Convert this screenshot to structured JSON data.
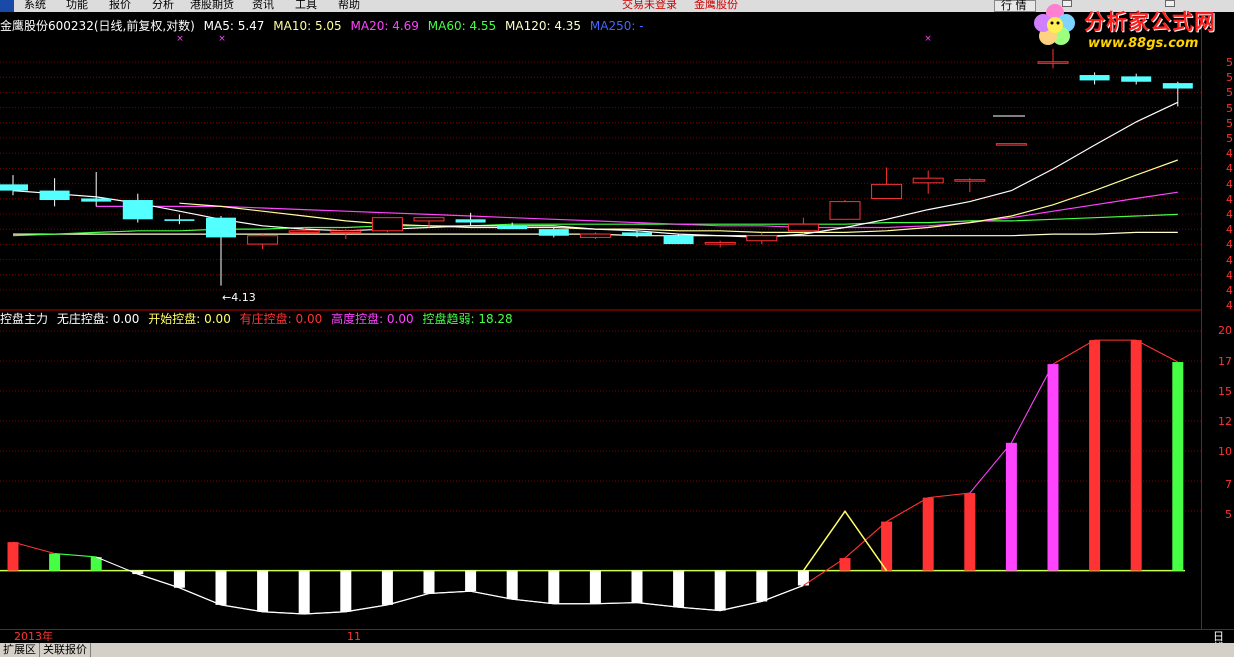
{
  "menu": {
    "items": [
      "系统",
      "功能",
      "报价",
      "分析",
      "港股期货",
      "资讯",
      "工具",
      "帮助"
    ],
    "status_login": "交易未登录",
    "status_name": "金鹰股份",
    "quote_button": "行 情"
  },
  "logo": {
    "title": "分析家公式网",
    "url": "www.88gs.com"
  },
  "price_header": {
    "stock": "金鹰股份",
    "code_desc": "600232(日线,前复权,对数)",
    "ma5": "MA5: 5.47",
    "ma10": "MA10: 5.05",
    "ma20": "MA20: 4.69",
    "ma60": "MA60: 4.55",
    "ma120": "MA120: 4.35",
    "ma250": "MA250: -"
  },
  "indicator_header": {
    "name": "控盘主力",
    "no_control": "无庄控盘: 0.00",
    "start_control": "开始控盘: 0.00",
    "has_control": "有庄控盘: 0.00",
    "high_control": "高度控盘: 0.00",
    "trend": "控盘趋弱: 18.28"
  },
  "annotations": {
    "low_price": "4.13"
  },
  "price_axis_ticks": [
    "5",
    "5",
    "5",
    "5",
    "5",
    "5",
    "4",
    "4",
    "4",
    "4",
    "4",
    "4",
    "4",
    "4",
    "4",
    "4",
    "4"
  ],
  "indicator_axis_ticks": [
    "20",
    "17",
    "15",
    "12",
    "10",
    "7",
    "5"
  ],
  "bottom_axis": {
    "date_left": "2013年",
    "date_mid": "11",
    "frequency": "日线"
  },
  "tabs": [
    "扩展区",
    "关联报价"
  ],
  "colors": {
    "up": "#ff3333",
    "down": "#54ffff",
    "ma5": "#ffffff",
    "ma10": "#ffff99",
    "ma20": "#ff44ff",
    "ma60": "#44ff44",
    "ma120": "#ffffcc",
    "ma250": "#4466ff",
    "no_control": "#ffffff",
    "start_control": "#ffff66",
    "has_control": "#ff3333",
    "high_control": "#ff44ff",
    "trend": "#44ff44",
    "grid": "#7a0000"
  },
  "chart_data": [
    {
      "type": "candlestick",
      "title": "金鹰股份",
      "candles": [
        {
          "o": 4.74,
          "h": 4.8,
          "l": 4.67,
          "c": 4.7
        },
        {
          "o": 4.7,
          "h": 4.78,
          "l": 4.6,
          "c": 4.64
        },
        {
          "o": 4.65,
          "h": 4.82,
          "l": 4.6,
          "c": 4.63
        },
        {
          "o": 4.64,
          "h": 4.68,
          "l": 4.5,
          "c": 4.52
        },
        {
          "o": 4.52,
          "h": 4.55,
          "l": 4.49,
          "c": 4.51
        },
        {
          "o": 4.53,
          "h": 4.54,
          "l": 4.13,
          "c": 4.41
        },
        {
          "o": 4.37,
          "h": 4.43,
          "l": 4.34,
          "c": 4.42
        },
        {
          "o": 4.44,
          "h": 4.47,
          "l": 4.43,
          "c": 4.45
        },
        {
          "o": 4.44,
          "h": 4.46,
          "l": 4.4,
          "c": 4.45
        },
        {
          "o": 4.45,
          "h": 4.52,
          "l": 4.44,
          "c": 4.53
        },
        {
          "o": 4.51,
          "h": 4.53,
          "l": 4.47,
          "c": 4.53
        },
        {
          "o": 4.52,
          "h": 4.56,
          "l": 4.48,
          "c": 4.5
        },
        {
          "o": 4.48,
          "h": 4.5,
          "l": 4.46,
          "c": 4.46
        },
        {
          "o": 4.46,
          "h": 4.47,
          "l": 4.41,
          "c": 4.42
        },
        {
          "o": 4.41,
          "h": 4.44,
          "l": 4.4,
          "c": 4.43
        },
        {
          "o": 4.44,
          "h": 4.45,
          "l": 4.41,
          "c": 4.42
        },
        {
          "o": 4.42,
          "h": 4.43,
          "l": 4.37,
          "c": 4.37
        },
        {
          "o": 4.37,
          "h": 4.39,
          "l": 4.35,
          "c": 4.38
        },
        {
          "o": 4.39,
          "h": 4.44,
          "l": 4.37,
          "c": 4.42
        },
        {
          "o": 4.45,
          "h": 4.53,
          "l": 4.44,
          "c": 4.49
        },
        {
          "o": 4.52,
          "h": 4.64,
          "l": 4.52,
          "c": 4.63
        },
        {
          "o": 4.65,
          "h": 4.85,
          "l": 4.65,
          "c": 4.74
        },
        {
          "o": 4.75,
          "h": 4.83,
          "l": 4.68,
          "c": 4.78
        },
        {
          "o": 4.77,
          "h": 4.78,
          "l": 4.69,
          "c": 4.77
        },
        {
          "o": 5.0,
          "h": 5.01,
          "l": 5.0,
          "c": 5.01
        },
        {
          "o": 5.6,
          "h": 5.7,
          "l": 5.55,
          "c": 5.6
        },
        {
          "o": 5.5,
          "h": 5.52,
          "l": 5.43,
          "c": 5.46
        },
        {
          "o": 5.49,
          "h": 5.51,
          "l": 5.43,
          "c": 5.45
        },
        {
          "o": 5.44,
          "h": 5.45,
          "l": 5.27,
          "c": 5.4
        }
      ],
      "ma5": [
        4.7,
        4.68,
        4.66,
        4.62,
        4.57,
        4.52,
        4.48,
        4.46,
        4.45,
        4.46,
        4.47,
        4.48,
        4.48,
        4.48,
        4.46,
        4.45,
        4.43,
        4.42,
        4.41,
        4.43,
        4.47,
        4.52,
        4.58,
        4.63,
        4.7,
        4.84,
        5.0,
        5.16,
        5.3
      ],
      "ma10": [
        null,
        null,
        null,
        null,
        4.62,
        4.6,
        4.57,
        4.54,
        4.51,
        4.49,
        4.48,
        4.47,
        4.47,
        4.47,
        4.46,
        4.46,
        4.45,
        4.45,
        4.44,
        4.44,
        4.44,
        4.45,
        4.47,
        4.5,
        4.54,
        4.61,
        4.7,
        4.8,
        4.9
      ],
      "ma20": [
        null,
        null,
        4.6,
        4.6,
        4.6,
        4.6,
        4.59,
        4.58,
        4.57,
        4.56,
        4.55,
        4.54,
        4.53,
        4.52,
        4.51,
        4.5,
        4.49,
        4.48,
        4.48,
        4.47,
        4.47,
        4.47,
        4.48,
        4.5,
        4.53,
        4.57,
        4.61,
        4.65,
        4.69
      ],
      "ma60": [
        4.42,
        4.43,
        4.44,
        4.45,
        4.45,
        4.46,
        4.46,
        4.47,
        4.47,
        4.48,
        4.48,
        4.48,
        4.49,
        4.49,
        4.49,
        4.49,
        4.49,
        4.49,
        4.49,
        4.49,
        4.49,
        4.5,
        4.5,
        4.51,
        4.51,
        4.52,
        4.53,
        4.54,
        4.55
      ],
      "ma120": [
        4.43,
        4.43,
        4.43,
        4.43,
        4.43,
        4.43,
        4.43,
        4.43,
        4.43,
        4.43,
        4.43,
        4.43,
        4.43,
        4.43,
        4.43,
        4.42,
        4.42,
        4.42,
        4.42,
        4.42,
        4.42,
        4.42,
        4.42,
        4.42,
        4.42,
        4.43,
        4.43,
        4.44,
        4.44
      ],
      "ylim": [
        4.05,
        5.8
      ],
      "scale": "log"
    },
    {
      "type": "bar",
      "title": "控盘主力",
      "bars": [
        {
          "v": 2.5,
          "c": "has"
        },
        {
          "v": 1.5,
          "c": "trend"
        },
        {
          "v": 1.2,
          "c": "trend"
        },
        {
          "v": -0.3,
          "c": "no"
        },
        {
          "v": -1.5,
          "c": "no"
        },
        {
          "v": -3.0,
          "c": "no"
        },
        {
          "v": -3.6,
          "c": "no"
        },
        {
          "v": -3.8,
          "c": "no"
        },
        {
          "v": -3.6,
          "c": "no"
        },
        {
          "v": -3.0,
          "c": "no"
        },
        {
          "v": -2.0,
          "c": "no"
        },
        {
          "v": -1.8,
          "c": "no"
        },
        {
          "v": -2.5,
          "c": "no"
        },
        {
          "v": -2.9,
          "c": "no"
        },
        {
          "v": -2.9,
          "c": "no"
        },
        {
          "v": -2.8,
          "c": "no"
        },
        {
          "v": -3.2,
          "c": "no"
        },
        {
          "v": -3.5,
          "c": "no"
        },
        {
          "v": -2.7,
          "c": "no"
        },
        {
          "v": -1.3,
          "c": "no"
        },
        {
          "v": 1.1,
          "c": "has"
        },
        {
          "v": 4.3,
          "c": "has"
        },
        {
          "v": 6.4,
          "c": "has"
        },
        {
          "v": 6.8,
          "c": "has"
        },
        {
          "v": 11.2,
          "c": "high"
        },
        {
          "v": 18.1,
          "c": "high"
        },
        {
          "v": 20.2,
          "c": "has"
        },
        {
          "v": 20.2,
          "c": "has"
        },
        {
          "v": 18.28,
          "c": "trend"
        }
      ],
      "start_line": [
        {
          "i": 19,
          "v": 0
        },
        {
          "i": 20,
          "v": 5.2
        },
        {
          "i": 21,
          "v": 0
        }
      ],
      "ylim": [
        -4.5,
        21
      ]
    }
  ]
}
